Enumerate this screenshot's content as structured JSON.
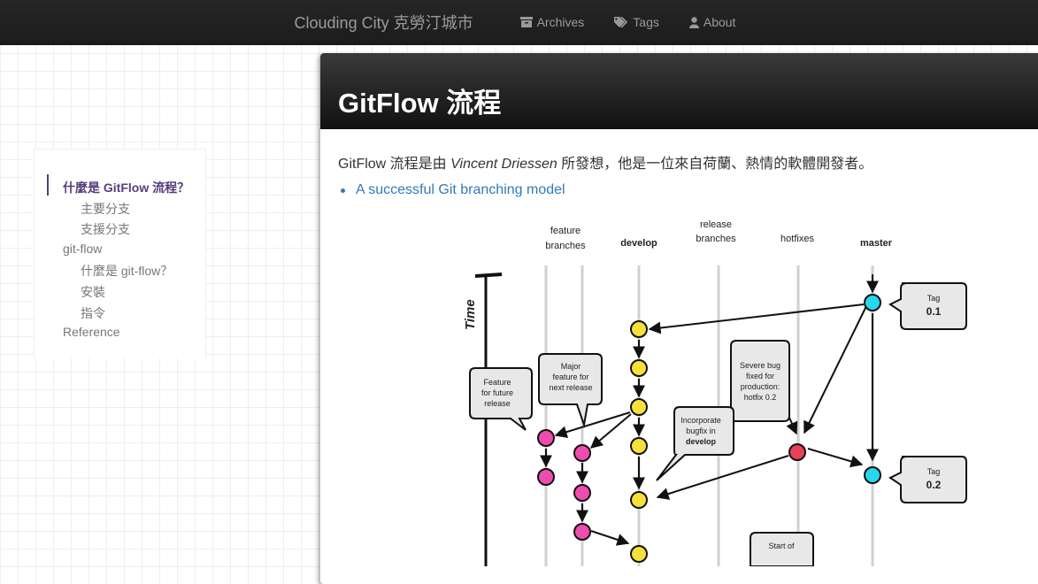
{
  "nav": {
    "brand": "Clouding City 克勞汀城市",
    "links": [
      {
        "label": "Archives",
        "icon": "archive-icon"
      },
      {
        "label": "Tags",
        "icon": "tags-icon"
      },
      {
        "label": "About",
        "icon": "user-icon"
      }
    ]
  },
  "toc": {
    "items": [
      {
        "label": "什麼是 GitFlow 流程？",
        "active": true
      },
      {
        "label": "主要分支"
      },
      {
        "label": "支援分支"
      },
      {
        "label": "git-flow"
      },
      {
        "label": "什麼是 git-flow？"
      },
      {
        "label": "安裝"
      },
      {
        "label": "指令"
      },
      {
        "label": "Reference"
      }
    ]
  },
  "article": {
    "title": "GitFlow 流程",
    "intro_before": "GitFlow 流程是由 ",
    "intro_author": "Vincent Driessen",
    "intro_after": " 所發想，他是一位來自荷蘭、熱情的軟體開發者。",
    "link": "A successful Git branching model"
  },
  "diagram": {
    "columns": {
      "feature1": "feature",
      "feature2": "branches",
      "develop": "develop",
      "release1": "release",
      "release2": "branches",
      "hotfixes": "hotfixes",
      "master": "master"
    },
    "time": "Time",
    "tag1_label": "Tag",
    "tag1_value": "0.1",
    "tag2_label": "Tag",
    "tag2_value": "0.2",
    "bubble_feature": [
      "Feature",
      "for future",
      "release"
    ],
    "bubble_major": [
      "Major",
      "feature for",
      "next release"
    ],
    "bubble_bug": [
      "Severe bug",
      "fixed for",
      "production:",
      "hotfix 0.2"
    ],
    "bubble_incorp": [
      "Incorporate",
      "bugfix in",
      "develop"
    ],
    "bubble_start": "Start of",
    "colors": {
      "develop": "#f6e03a",
      "feature": "#ee4cb0",
      "hotfix": "#e8415a",
      "master": "#27d7ee"
    }
  }
}
